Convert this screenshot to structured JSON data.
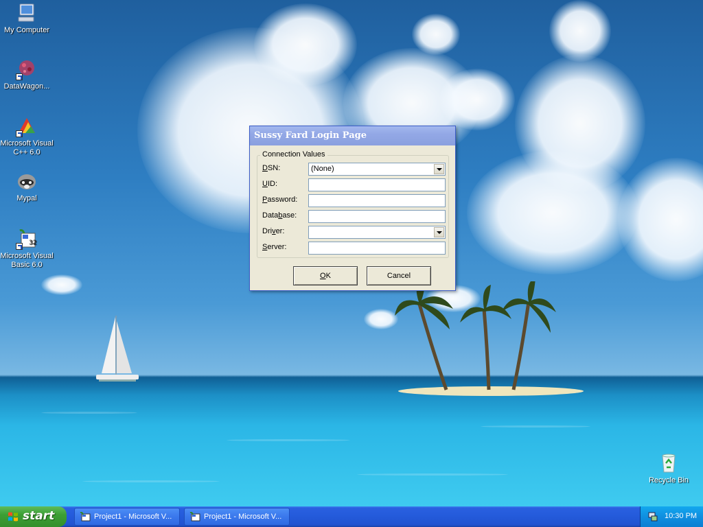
{
  "desktop": {
    "icons": [
      {
        "label": "My Computer",
        "icon": "computer-icon"
      },
      {
        "label": "DataWagon...",
        "icon": "datawagon-icon"
      },
      {
        "label": "Microsoft Visual C++ 6.0",
        "icon": "visual-cpp-icon"
      },
      {
        "label": "Mypal",
        "icon": "mypal-raccoon-icon"
      },
      {
        "label": "Microsoft Visual Basic 6.0",
        "icon": "visual-basic-icon"
      },
      {
        "label": "Recycle Bin",
        "icon": "recycle-bin-icon"
      }
    ]
  },
  "dialog": {
    "title": "Sussy Fard Login Page",
    "group_label": "Connection Values",
    "fields": {
      "dsn": {
        "label_first": "D",
        "label_rest": "SN:",
        "value": "(None)"
      },
      "uid": {
        "label_first": "U",
        "label_rest": "ID:",
        "value": ""
      },
      "password": {
        "label_first": "P",
        "label_rest": "assword:",
        "value": ""
      },
      "database": {
        "label_before": "Data",
        "label_ul": "b",
        "label_after": "ase:",
        "value": ""
      },
      "driver": {
        "label_before": "Dri",
        "label_ul": "v",
        "label_after": "er:",
        "value": ""
      },
      "server": {
        "label_first": "S",
        "label_rest": "erver:",
        "value": ""
      }
    },
    "ok_first": "O",
    "ok_rest": "K",
    "cancel_label": "Cancel"
  },
  "taskbar": {
    "start_label": "start",
    "tasks": [
      {
        "label": "Project1 - Microsoft V..."
      },
      {
        "label": "Project1 - Microsoft V..."
      }
    ],
    "clock": "10:30 PM"
  },
  "colors": {
    "taskbar_blue": "#245bdb",
    "start_green": "#3c9f34",
    "dialog_face": "#ece9d8",
    "title_inactive": "#93a8e6"
  }
}
